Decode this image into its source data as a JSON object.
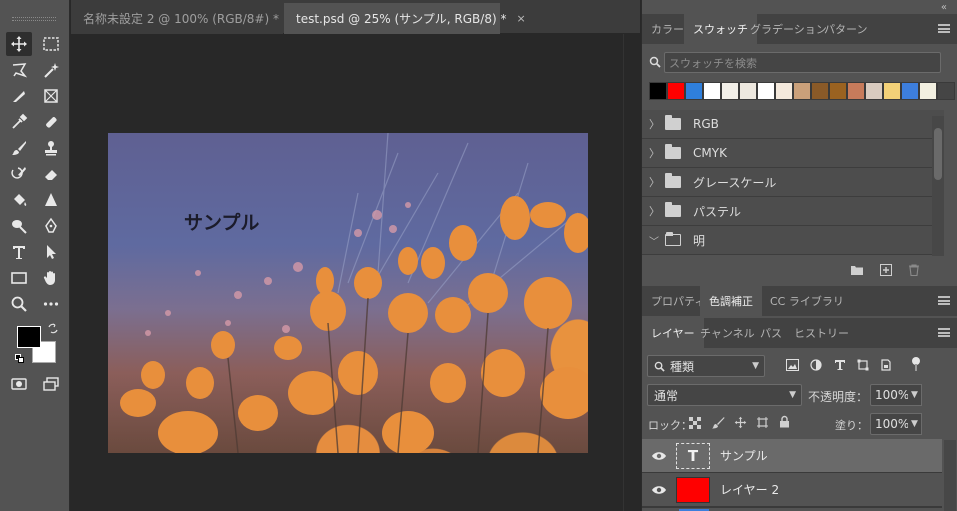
{
  "document_tabs": [
    {
      "label": "名称未設定 2 @ 100% (RGB/8#) *",
      "close": "×",
      "active": false
    },
    {
      "label": "test.psd @ 25% (サンプル, RGB/8) *",
      "close": "×",
      "active": true
    }
  ],
  "canvas": {
    "text_layer_content": "サンプル"
  },
  "swatches_panel": {
    "tabs": [
      "カラー",
      "スウォッチ",
      "グラデーション",
      "パターン"
    ],
    "active_tab": "スウォッチ",
    "search_placeholder": "スウォッチを検索",
    "colors": [
      "#000000",
      "#ff0000",
      "#2f7fdc",
      "#ffffff",
      "#f2efe8",
      "#ede8df",
      "#ffffff",
      "#f4e9dc",
      "#caa07a",
      "#8a5a28",
      "#9a6220",
      "#c77b5b",
      "#d9cbbf",
      "#f3d178",
      "#3d7edc",
      "#f2efe0"
    ],
    "folders": [
      {
        "name": "RGB",
        "open": false
      },
      {
        "name": "CMYK",
        "open": false
      },
      {
        "name": "グレースケール",
        "open": false
      },
      {
        "name": "パステル",
        "open": false
      },
      {
        "name": "明",
        "open": true
      }
    ]
  },
  "properties_panel": {
    "tabs": [
      "プロパティ",
      "色調補正",
      "CC ライブラリ"
    ],
    "active_tab": "色調補正"
  },
  "layers_panel": {
    "tabs": [
      "レイヤー",
      "チャンネル",
      "パス",
      "ヒストリー"
    ],
    "active_tab": "レイヤー",
    "kind_filter": "種類",
    "blend_mode": "通常",
    "opacity_label": "不透明度：",
    "opacity_value": "100%",
    "lock_label": "ロック：",
    "fill_label": "塗り：",
    "fill_value": "100%",
    "layers": [
      {
        "name": "サンプル",
        "type": "text",
        "selected": true,
        "thumb_glyph": "T"
      },
      {
        "name": "レイヤー 2",
        "type": "fill",
        "selected": false,
        "thumb_color": "#ff0000"
      }
    ]
  }
}
